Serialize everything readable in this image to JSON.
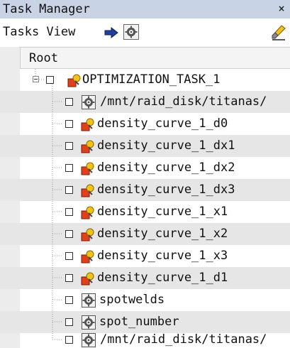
{
  "window": {
    "title": "Task Manager",
    "close_label": "×"
  },
  "toolbar": {
    "tasks_view_label": "Tasks View",
    "arrow_icon": "arrow-right-icon",
    "gear_icon": "gear-icon",
    "brush_icon": "brush-icon"
  },
  "tree": {
    "root_label": "Root",
    "items": [
      {
        "label": "OPTIMIZATION_TASK_1",
        "icon": "optimization-icon",
        "level": 1
      },
      {
        "label": "/mnt/raid_disk/titanas/",
        "icon": "gear-icon",
        "level": 2
      },
      {
        "label": "density_curve_1_d0",
        "icon": "optimization-icon",
        "level": 2
      },
      {
        "label": "density_curve_1_dx1",
        "icon": "optimization-icon",
        "level": 2
      },
      {
        "label": "density_curve_1_dx2",
        "icon": "optimization-icon",
        "level": 2
      },
      {
        "label": "density_curve_1_dx3",
        "icon": "optimization-icon",
        "level": 2
      },
      {
        "label": "density_curve_1_x1",
        "icon": "optimization-icon",
        "level": 2
      },
      {
        "label": "density_curve_1_x2",
        "icon": "optimization-icon",
        "level": 2
      },
      {
        "label": "density_curve_1_x3",
        "icon": "optimization-icon",
        "level": 2
      },
      {
        "label": "density_curve_1_d1",
        "icon": "optimization-icon",
        "level": 2
      },
      {
        "label": "spotwelds",
        "icon": "gear-icon",
        "level": 2
      },
      {
        "label": "spot_number",
        "icon": "gear-icon",
        "level": 2
      },
      {
        "label": "/mnt/raid_disk/titanas/",
        "icon": "gear-icon",
        "level": 2
      }
    ]
  },
  "colors": {
    "titlebar": "#c8d3e6",
    "stripe": "#e6e6e6",
    "icon_red": "#e0401c",
    "icon_yellow": "#f2c21a"
  }
}
